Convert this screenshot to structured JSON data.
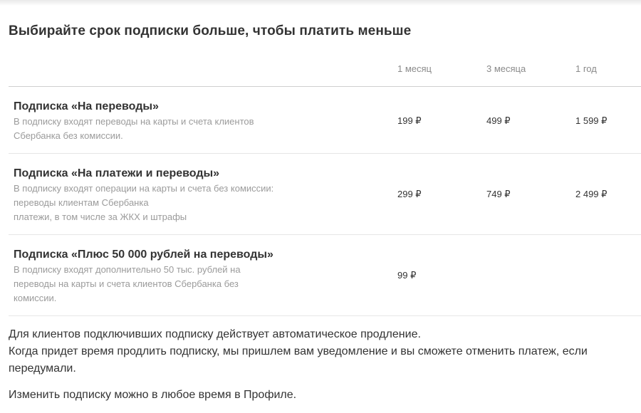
{
  "title": "Выбирайте срок подписки больше, чтобы платить меньше",
  "columns": [
    "1 месяц",
    "3 месяца",
    "1 год"
  ],
  "plans": [
    {
      "name": "Подписка «На переводы»",
      "description_lines": [
        "В подписку входят переводы на карты и счета клиентов",
        "Сбербанка без комиссии."
      ],
      "prices": [
        "199 ₽",
        "499 ₽",
        "1 599 ₽"
      ]
    },
    {
      "name": "Подписка «На платежи и переводы»",
      "description_lines": [
        "В подписку входят операции на карты и счета без комиссии:",
        "переводы клиентам Сбербанка",
        "платежи, в том числе за ЖКХ и штрафы"
      ],
      "prices": [
        "299 ₽",
        "749 ₽",
        "2 499 ₽"
      ]
    },
    {
      "name": "Подписка «Плюс 50 000 рублей на переводы»",
      "description_lines": [
        "В подписку входят дополнительно 50 тыс. рублей на",
        "переводы на карты и счета клиентов Сбербанка без",
        "комиссии."
      ],
      "prices": [
        "99 ₽",
        "",
        ""
      ]
    }
  ],
  "footer": {
    "auto_renewal": "Для клиентов подключивших подписку действует автоматическое продление.",
    "notification_line1": "Когда придет время продлить подписку, мы пришлем вам уведомление и вы сможете отменить платеж, если",
    "notification_line2": "передумали.",
    "change": "Изменить подписку можно в любое время в Профиле."
  }
}
